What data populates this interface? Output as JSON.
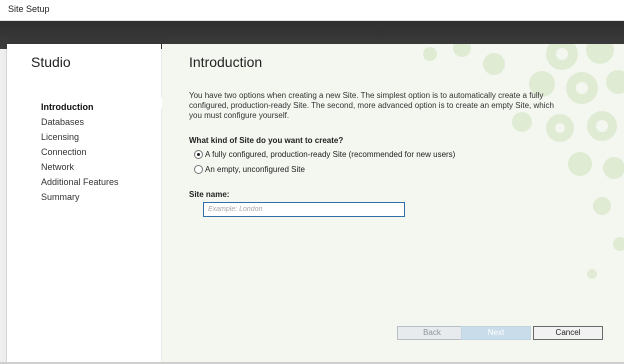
{
  "window": {
    "title": "Site Setup"
  },
  "sidebar": {
    "title": "Studio",
    "items": [
      {
        "label": "Introduction",
        "active": true
      },
      {
        "label": "Databases",
        "active": false
      },
      {
        "label": "Licensing",
        "active": false
      },
      {
        "label": "Connection",
        "active": false
      },
      {
        "label": "Network",
        "active": false
      },
      {
        "label": "Additional Features",
        "active": false
      },
      {
        "label": "Summary",
        "active": false
      }
    ]
  },
  "main": {
    "heading": "Introduction",
    "intro_text": "You have two options when creating a new Site. The simplest option is to automatically create a fully configured, production-ready Site. The second, more advanced option is to create an empty Site, which you must configure yourself.",
    "question": "What kind of Site do you want to create?",
    "options": [
      {
        "label": "A fully configured, production-ready Site (recommended for new users)",
        "selected": true
      },
      {
        "label": "An empty, unconfigured Site",
        "selected": false
      }
    ],
    "site_name": {
      "label": "Site name:",
      "placeholder": "Example: London",
      "value": ""
    }
  },
  "buttons": {
    "back": "Back",
    "next": "Next",
    "cancel": "Cancel"
  },
  "colors": {
    "accent": "#2f6ea8",
    "main_background": "#f4f7f0",
    "header_band": "#333333",
    "decoration": "#d9e8c9"
  }
}
